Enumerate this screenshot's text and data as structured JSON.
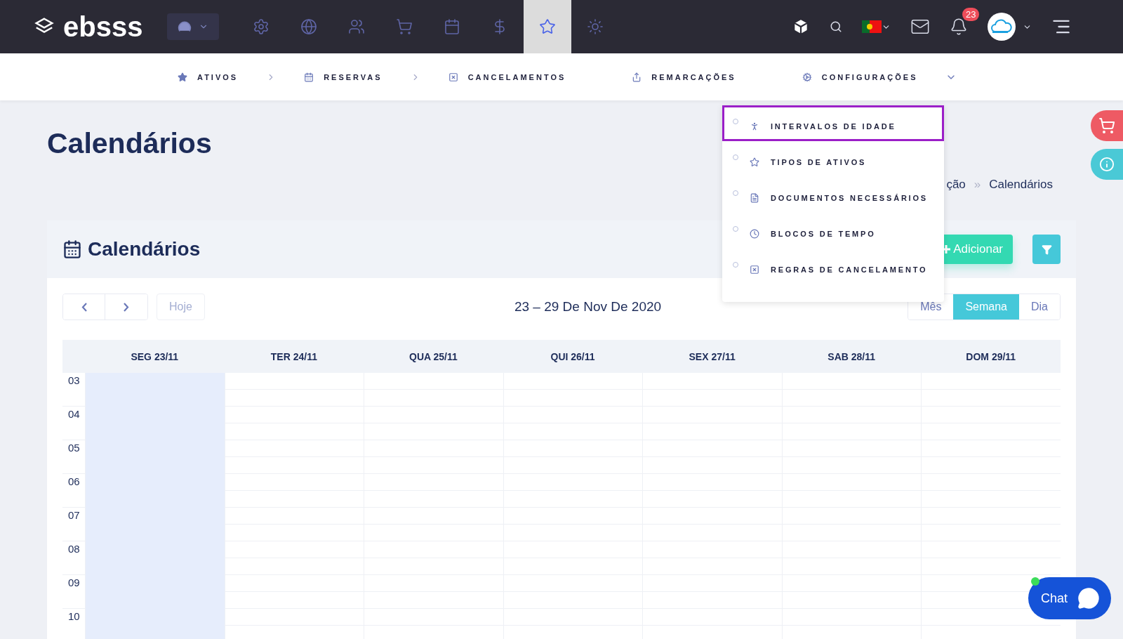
{
  "topbar": {
    "logo": "ebsss",
    "nav_buttons": [
      {
        "selected": false
      },
      {
        "selected": false
      },
      {
        "selected": false
      },
      {
        "selected": false
      },
      {
        "selected": false
      },
      {
        "selected": false
      },
      {
        "selected": true
      },
      {
        "selected": false
      }
    ],
    "notification_count": "23"
  },
  "subnav": [
    {
      "label": "ATIVOS",
      "kind": "step"
    },
    {
      "label": "RESERVAS",
      "kind": "step"
    },
    {
      "label": "CANCELAMENTOS",
      "kind": "plain"
    },
    {
      "label": "REMARCAÇÕES",
      "kind": "plain"
    },
    {
      "label": "CONFIGURAÇÕES",
      "kind": "dropdown"
    }
  ],
  "dropdown": [
    {
      "label": "INTERVALOS DE IDADE",
      "highlighted": true
    },
    {
      "label": "TIPOS DE ATIVOS",
      "highlighted": false
    },
    {
      "label": "DOCUMENTOS NECESSÁRIOS",
      "highlighted": false
    },
    {
      "label": "BLOCOS DE TEMPO",
      "highlighted": false
    },
    {
      "label": "REGRAS DE CANCELAMENTO",
      "highlighted": false
    }
  ],
  "page_title": "Calendários",
  "breadcrumb": {
    "items": [
      "ção",
      "Calendários"
    ],
    "separator": "»"
  },
  "card": {
    "title": "Calendários",
    "add_button": "Adicionar"
  },
  "calendar": {
    "today_button": "Hoje",
    "range": "23 – 29 De Nov De 2020",
    "views": [
      {
        "label": "Mês",
        "selected": false
      },
      {
        "label": "Semana",
        "selected": true
      },
      {
        "label": "Dia",
        "selected": false
      }
    ],
    "columns": [
      {
        "label": "SEG 23/11",
        "today": true
      },
      {
        "label": "TER 24/11",
        "today": false
      },
      {
        "label": "QUA 25/11",
        "today": false
      },
      {
        "label": "QUI 26/11",
        "today": false
      },
      {
        "label": "SEX 27/11",
        "today": false
      },
      {
        "label": "SAB 28/11",
        "today": false
      },
      {
        "label": "DOM 29/11",
        "today": false
      }
    ],
    "hours": [
      "03",
      "04",
      "05",
      "06",
      "07",
      "08",
      "09",
      "10"
    ]
  },
  "chat": {
    "label": "Chat",
    "online": true
  }
}
